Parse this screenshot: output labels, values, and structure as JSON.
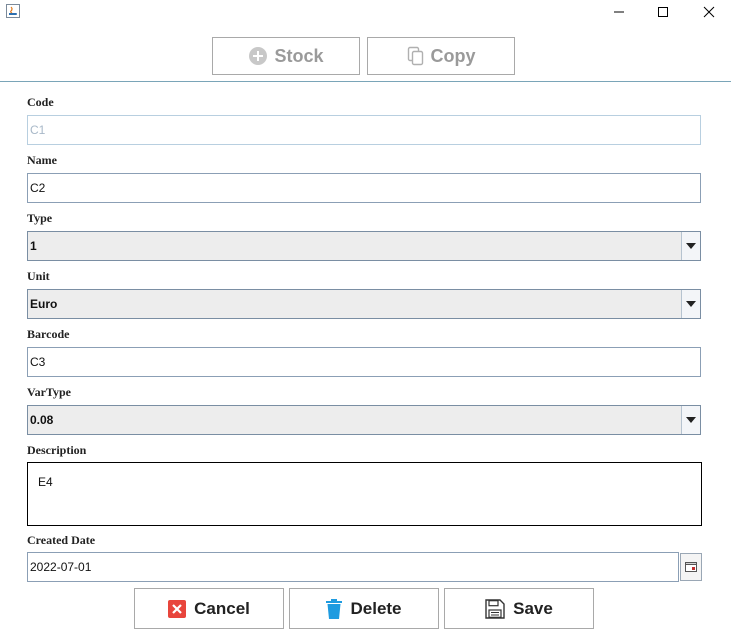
{
  "window": {
    "icon": "java-icon"
  },
  "toolbar": {
    "stock_label": "Stock",
    "copy_label": "Copy"
  },
  "form": {
    "code": {
      "label": "Code",
      "value": "C1"
    },
    "name": {
      "label": "Name",
      "value": "C2"
    },
    "type": {
      "label": "Type",
      "value": "1"
    },
    "unit": {
      "label": "Unit",
      "value": "Euro"
    },
    "barcode": {
      "label": "Barcode",
      "value": "C3"
    },
    "vartype": {
      "label": "VarType",
      "value": "0.08"
    },
    "description": {
      "label": "Description",
      "value": "E4"
    },
    "created_date": {
      "label": "Created Date",
      "value": "2022-07-01"
    }
  },
  "actions": {
    "cancel_label": "Cancel",
    "delete_label": "Delete",
    "save_label": "Save"
  },
  "colors": {
    "cancel_icon": "#e8453c",
    "delete_icon": "#1e9be0",
    "disabled_text": "#9a9a9a"
  }
}
